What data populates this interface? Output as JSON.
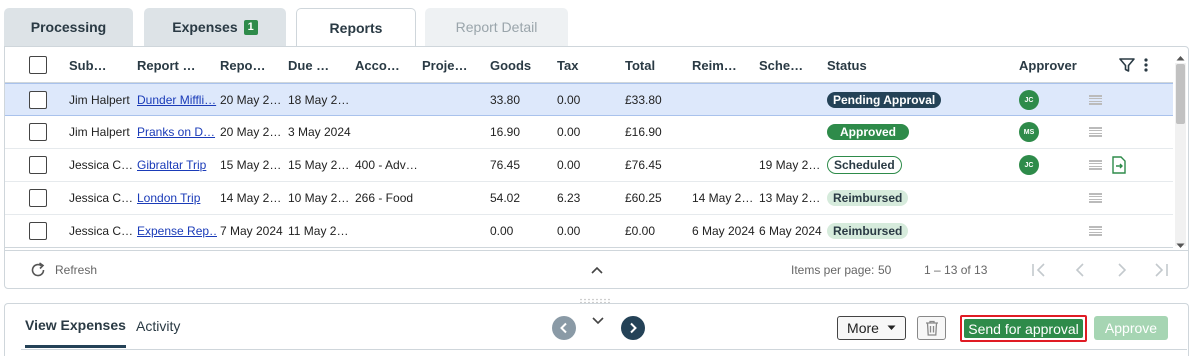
{
  "tabs": {
    "processing": "Processing",
    "expenses": "Expenses",
    "expenses_badge": "1",
    "reports": "Reports",
    "report_detail": "Report Detail"
  },
  "grid": {
    "headers": {
      "submitter": "Sub…",
      "report_name": "Report …",
      "report_date": "Repo…",
      "due_date": "Due …",
      "account": "Acco…",
      "project": "Proje…",
      "goods": "Goods",
      "tax": "Tax",
      "total": "Total",
      "reimbursed": "Reim…",
      "scheduled": "Sche…",
      "status": "Status",
      "approver": "Approver"
    },
    "rows": [
      {
        "submitter": "Jim Halpert",
        "report_name": "Dunder Miffli…",
        "report_date": "20 May 2…",
        "due_date": "18 May 2…",
        "account": "",
        "project": "",
        "goods": "33.80",
        "tax": "0.00",
        "total": "£33.80",
        "reimbursed": "",
        "scheduled": "",
        "status": "Pending Approval",
        "approver": "JC"
      },
      {
        "submitter": "Jim Halpert",
        "report_name": "Pranks on D…",
        "report_date": "20 May 2…",
        "due_date": "3 May 2024",
        "account": "",
        "project": "",
        "goods": "16.90",
        "tax": "0.00",
        "total": "£16.90",
        "reimbursed": "",
        "scheduled": "",
        "status": "Approved",
        "approver": "MS"
      },
      {
        "submitter": "Jessica C…",
        "report_name": "Gibraltar Trip",
        "report_date": "15 May 2…",
        "due_date": "15 May 2…",
        "account": "400 - Adv…",
        "project": "",
        "goods": "76.45",
        "tax": "0.00",
        "total": "£76.45",
        "reimbursed": "",
        "scheduled": "19 May 2…",
        "status": "Scheduled",
        "approver": "JC"
      },
      {
        "submitter": "Jessica C…",
        "report_name": "London Trip",
        "report_date": "14 May 2…",
        "due_date": "10 May 2…",
        "account": "266 - Food",
        "project": "",
        "goods": "54.02",
        "tax": "6.23",
        "total": "£60.25",
        "reimbursed": "14 May 2…",
        "scheduled": "13 May 2…",
        "status": "Reimbursed",
        "approver": ""
      },
      {
        "submitter": "Jessica C…",
        "report_name": "Expense Rep…",
        "report_date": "7 May 2024",
        "due_date": "11 May 2…",
        "account": "",
        "project": "",
        "goods": "0.00",
        "tax": "0.00",
        "total": "£0.00",
        "reimbursed": "6 May 2024",
        "scheduled": "6 May 2024",
        "status": "Reimbursed",
        "approver": ""
      }
    ]
  },
  "footer": {
    "refresh": "Refresh",
    "items_per_page_label": "Items per page:",
    "items_per_page_value": "50",
    "range": "1 – 13 of 13"
  },
  "bottom": {
    "tab_view_expenses": "View Expenses",
    "tab_activity": "Activity",
    "more": "More",
    "send_for_approval": "Send for approval",
    "approve": "Approve"
  },
  "colors": {
    "brand_green": "#2e8b4a",
    "navy": "#244257",
    "highlight_red": "#e01b24",
    "selected_row": "#dde8fb"
  }
}
